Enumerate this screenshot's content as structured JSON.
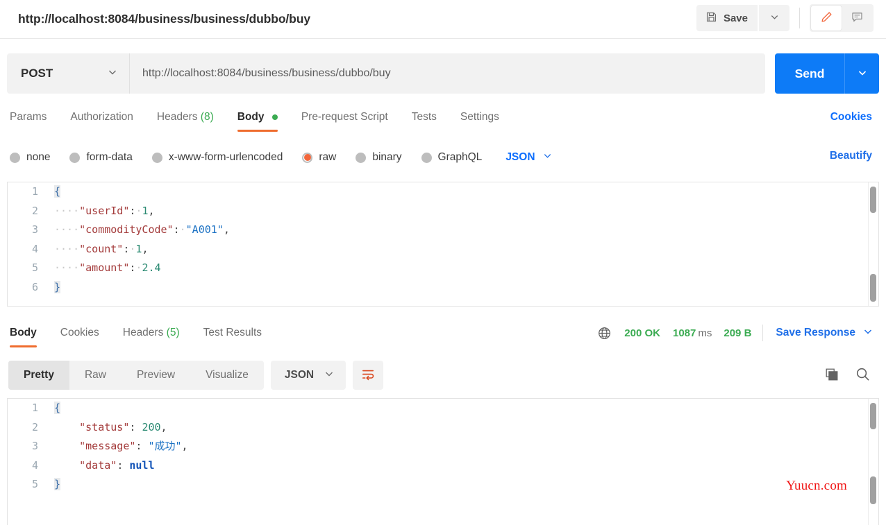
{
  "window": {
    "request_title": "http://localhost:8084/business/business/dubbo/buy"
  },
  "toolbar": {
    "save_label": "Save",
    "save_icon": "floppy-disk-icon",
    "save_caret_icon": "chevron-down-icon",
    "edit_icon": "pencil-icon",
    "comment_icon": "comment-icon"
  },
  "url_bar": {
    "method": "POST",
    "method_caret_icon": "chevron-down-icon",
    "url": "http://localhost:8084/business/business/dubbo/buy",
    "url_placeholder": "Enter request URL",
    "send_label": "Send",
    "send_caret_icon": "chevron-down-icon",
    "send_color": "#0d7bf7"
  },
  "request_tabs": {
    "items": [
      {
        "label": "Params",
        "count": "",
        "active": false,
        "dot": false
      },
      {
        "label": "Authorization",
        "count": "",
        "active": false,
        "dot": false
      },
      {
        "label": "Headers",
        "count": "(8)",
        "active": false,
        "dot": false
      },
      {
        "label": "Body",
        "count": "",
        "active": true,
        "dot": true
      },
      {
        "label": "Pre-request Script",
        "count": "",
        "active": false,
        "dot": false
      },
      {
        "label": "Tests",
        "count": "",
        "active": false,
        "dot": false
      },
      {
        "label": "Settings",
        "count": "",
        "active": false,
        "dot": false
      }
    ],
    "cookies_label": "Cookies",
    "active_color": "#ef6c2e",
    "count_color": "#3bab52"
  },
  "body_type": {
    "options": [
      {
        "label": "none",
        "selected": false
      },
      {
        "label": "form-data",
        "selected": false
      },
      {
        "label": "x-www-form-urlencoded",
        "selected": false
      },
      {
        "label": "raw",
        "selected": true
      },
      {
        "label": "binary",
        "selected": false
      },
      {
        "label": "GraphQL",
        "selected": false
      }
    ],
    "format": "JSON",
    "format_caret_icon": "chevron-down-icon",
    "beautify_label": "Beautify",
    "selected_color": "#f2663b"
  },
  "request_body": {
    "lines": [
      {
        "no": "1",
        "text": "{"
      },
      {
        "no": "2",
        "text": "    \"userId\": 1,"
      },
      {
        "no": "3",
        "text": "    \"commodityCode\": \"A001\","
      },
      {
        "no": "4",
        "text": "    \"count\": 1,"
      },
      {
        "no": "5",
        "text": "    \"amount\": 2.4"
      },
      {
        "no": "6",
        "text": "}"
      }
    ]
  },
  "response_tabs": {
    "items": [
      {
        "label": "Body",
        "count": "",
        "active": true
      },
      {
        "label": "Cookies",
        "count": "",
        "active": false
      },
      {
        "label": "Headers",
        "count": "(5)",
        "active": false
      },
      {
        "label": "Test Results",
        "count": "",
        "active": false
      }
    ]
  },
  "response_meta": {
    "globe_icon": "globe-icon",
    "status": "200 OK",
    "time_value": "1087",
    "time_unit": "ms",
    "size": "209 B",
    "save_response_label": "Save Response",
    "save_response_caret_icon": "chevron-down-icon",
    "status_color": "#3bab52"
  },
  "response_toolbar": {
    "views": [
      {
        "label": "Pretty",
        "active": true
      },
      {
        "label": "Raw",
        "active": false
      },
      {
        "label": "Preview",
        "active": false
      },
      {
        "label": "Visualize",
        "active": false
      }
    ],
    "format": "JSON",
    "format_caret_icon": "chevron-down-icon",
    "wrap_icon": "wrap-lines-icon",
    "copy_icon": "copy-icon",
    "search_icon": "search-icon"
  },
  "response_body": {
    "lines": [
      {
        "no": "1",
        "text": "{"
      },
      {
        "no": "2",
        "text": "    \"status\": 200,"
      },
      {
        "no": "3",
        "text": "    \"message\": \"成功\","
      },
      {
        "no": "4",
        "text": "    \"data\": null"
      },
      {
        "no": "5",
        "text": "}"
      }
    ]
  },
  "watermark": {
    "text": "Yuucn.com",
    "color": "#f01414"
  }
}
